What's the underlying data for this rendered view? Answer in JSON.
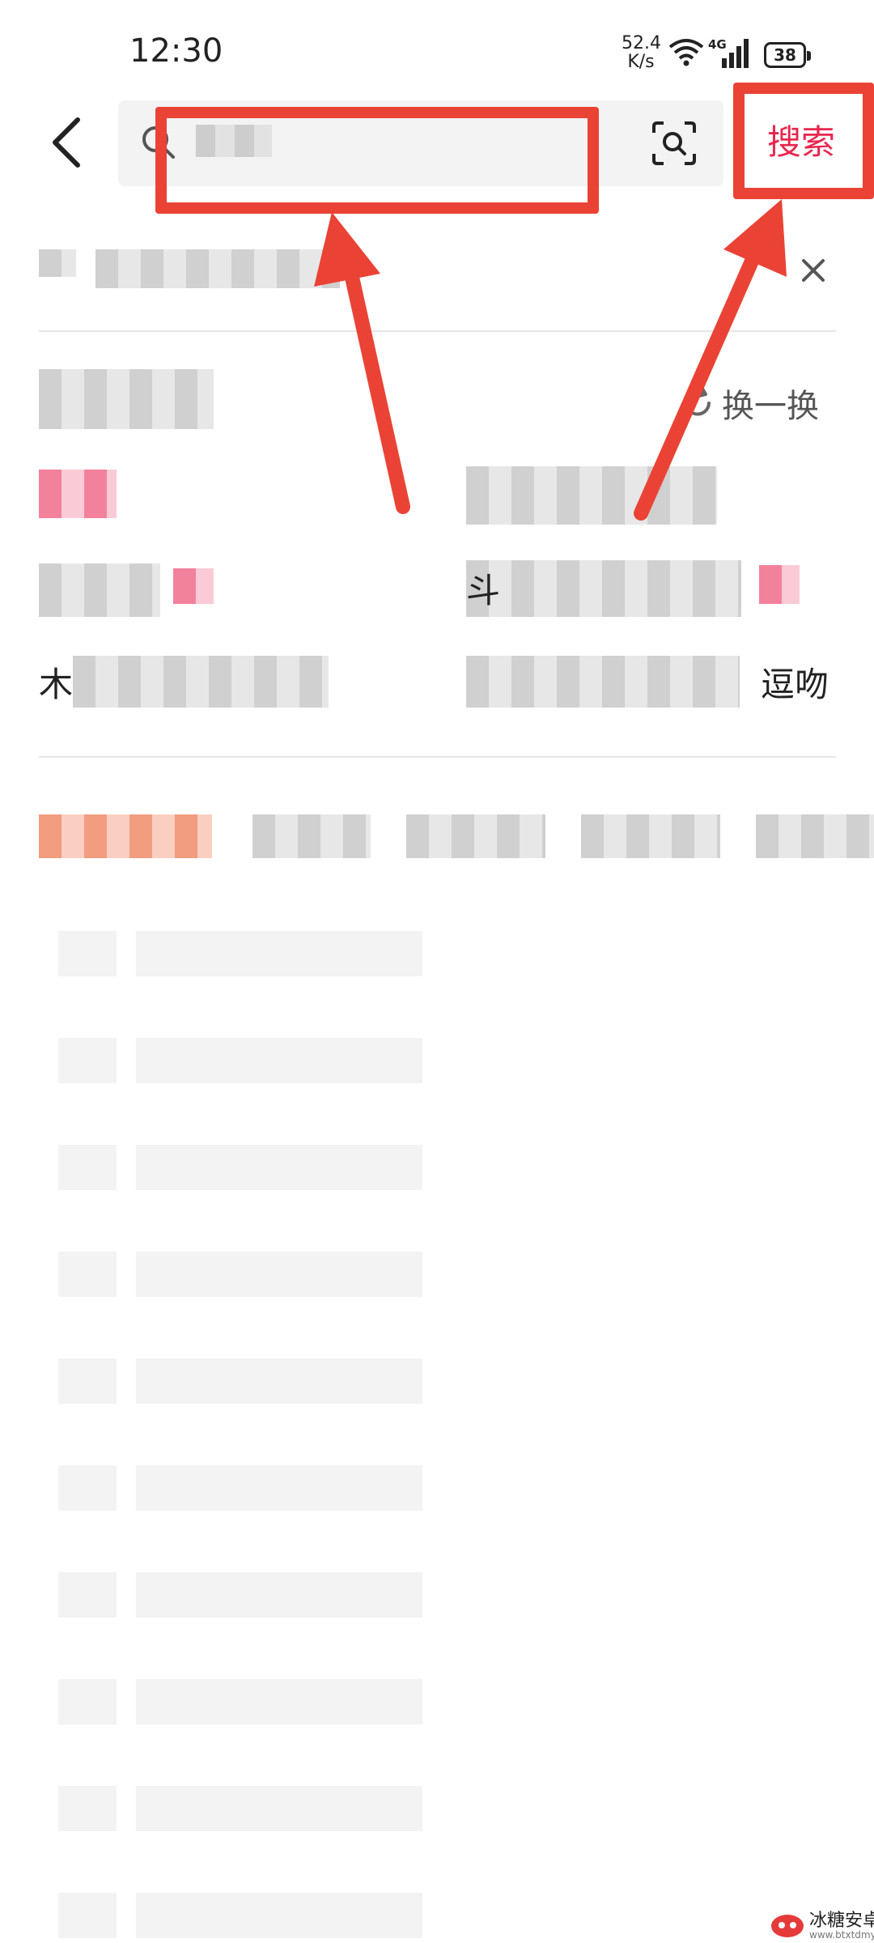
{
  "status_bar": {
    "time": "12:30",
    "net_speed_value": "52.4",
    "net_speed_unit": "K/s",
    "network_type": "4G",
    "battery_level": "38"
  },
  "search": {
    "input_value": "",
    "button_label": "搜索"
  },
  "guess_section": {
    "refresh_label": "换一换",
    "suggestions_visible_text": [
      "木",
      "斗",
      "逗吻"
    ]
  },
  "skeleton_rows": 10,
  "watermark": {
    "title": "冰糖安卓网",
    "url": "www.btxtdmy.com"
  },
  "colors": {
    "accent": "#e8264d",
    "annotation": "#ea4335",
    "skeleton": "#f3f3f3",
    "divider": "#e6e6e6"
  },
  "icons": [
    "back-arrow-icon",
    "search-icon",
    "scan-icon",
    "close-icon",
    "refresh-icon",
    "wifi-icon",
    "signal-icon",
    "battery-icon"
  ]
}
